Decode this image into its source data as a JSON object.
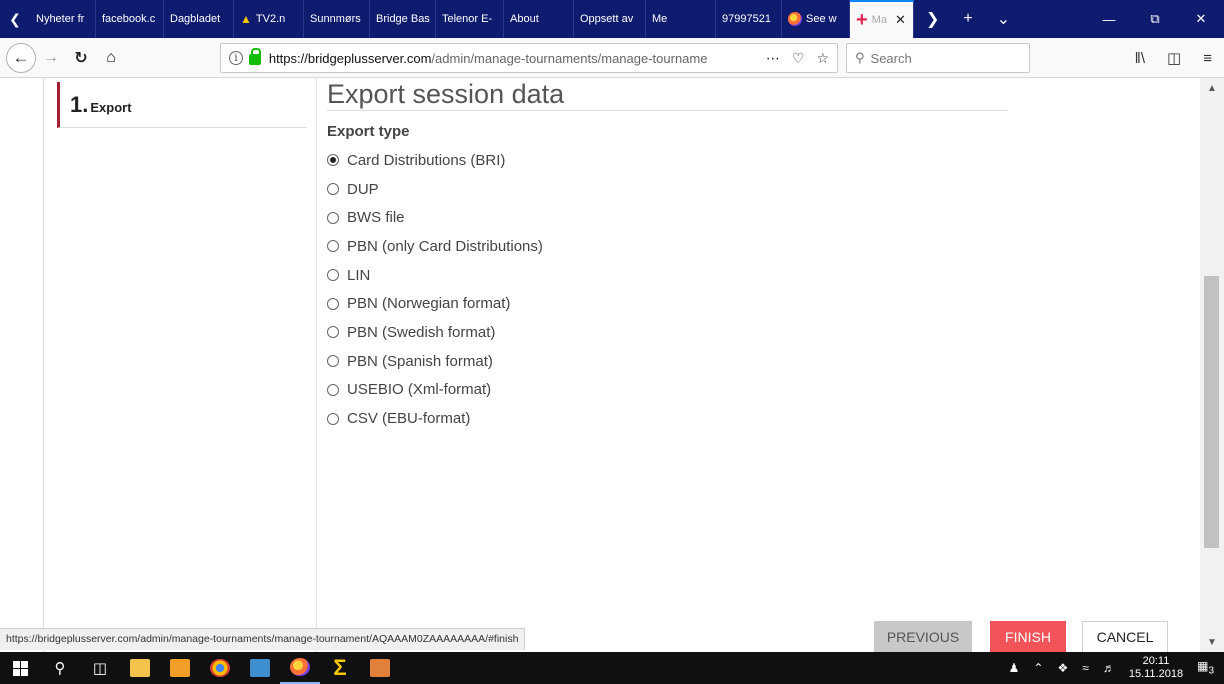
{
  "browser": {
    "tabs": [
      {
        "label": "Nyheter fr",
        "fade": "a"
      },
      {
        "label": "facebook.c",
        "fade": ""
      },
      {
        "label": "Dagbladet",
        "fade": ""
      },
      {
        "label": "TV2.n",
        "fade": "o"
      },
      {
        "label": "Sunnmørs",
        "fade": ""
      },
      {
        "label": "Bridge Bas",
        "fade": ""
      },
      {
        "label": "Telenor E-",
        "fade": ""
      },
      {
        "label": "About",
        "fade": ""
      },
      {
        "label": "Oppsett av",
        "fade": ""
      },
      {
        "label": "Me",
        "fade": ""
      },
      {
        "label": "97997521",
        "fade": ""
      },
      {
        "label": "See w",
        "fade": ""
      },
      {
        "label": "Ma",
        "fade": ""
      }
    ],
    "url_domain": "https://bridgeplusserver.com",
    "url_path": "/admin/manage-tournaments/manage-tourname",
    "search_placeholder": "Search"
  },
  "steps": {
    "number": "1.",
    "label": "Export"
  },
  "main": {
    "title": "Export session data",
    "export_type_label": "Export type",
    "selected_index": 0,
    "options": [
      "Card Distributions (BRI)",
      "DUP",
      "BWS file",
      "PBN (only Card Distributions)",
      "LIN",
      "PBN (Norwegian format)",
      "PBN (Swedish format)",
      "PBN (Spanish format)",
      "USEBIO (Xml-format)",
      "CSV (EBU-format)"
    ]
  },
  "status_url": "https://bridgeplusserver.com/admin/manage-tournaments/manage-tournament/AQAAAM0ZAAAAAAAA/#finish",
  "buttons": {
    "previous": "PREVIOUS",
    "finish": "FINISH",
    "cancel": "CANCEL"
  },
  "taskbar": {
    "time": "20:11",
    "date": "15.11.2018",
    "notifications": "3"
  },
  "colors": {
    "tabstrip": "#0f1b6e",
    "step_accent": "#a31f34",
    "finish": "#f25358",
    "previous": "#c8c8c8"
  }
}
